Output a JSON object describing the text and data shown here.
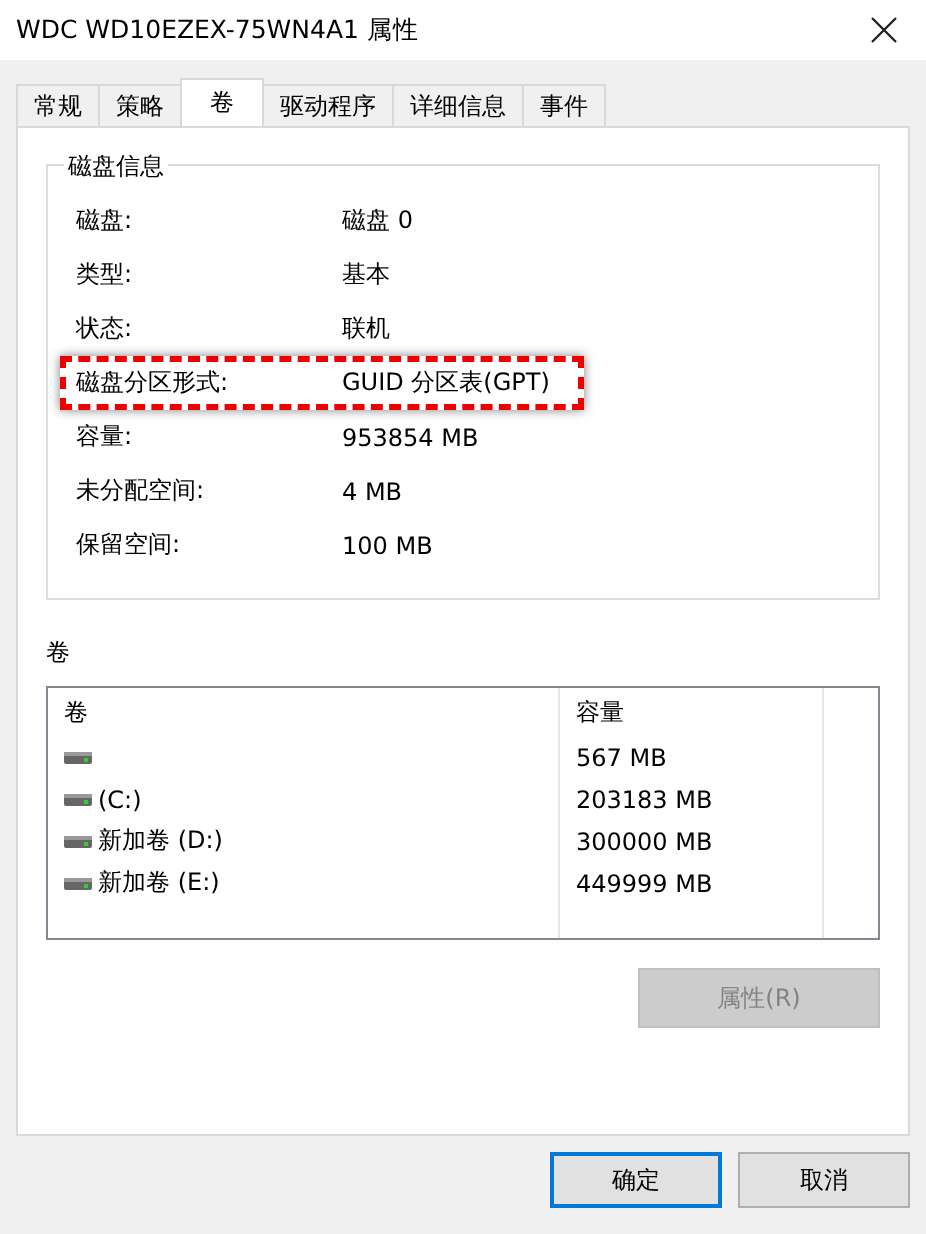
{
  "window": {
    "title": "WDC WD10EZEX-75WN4A1 属性"
  },
  "tabs": [
    {
      "label": "常规",
      "selected": false
    },
    {
      "label": "策略",
      "selected": false
    },
    {
      "label": "卷",
      "selected": true
    },
    {
      "label": "驱动程序",
      "selected": false
    },
    {
      "label": "详细信息",
      "selected": false
    },
    {
      "label": "事件",
      "selected": false
    }
  ],
  "disk_info": {
    "title": "磁盘信息",
    "rows": [
      {
        "label": "磁盘:",
        "value": "磁盘 0",
        "highlighted": false
      },
      {
        "label": "类型:",
        "value": "基本",
        "highlighted": false
      },
      {
        "label": "状态:",
        "value": "联机",
        "highlighted": false
      },
      {
        "label": "磁盘分区形式:",
        "value": "GUID 分区表(GPT)",
        "highlighted": true
      },
      {
        "label": "容量:",
        "value": "953854 MB",
        "highlighted": false
      },
      {
        "label": "未分配空间:",
        "value": "4 MB",
        "highlighted": false
      },
      {
        "label": "保留空间:",
        "value": "100 MB",
        "highlighted": false
      }
    ]
  },
  "volumes": {
    "title": "卷",
    "columns": [
      "卷",
      "容量"
    ],
    "rows": [
      {
        "name": "",
        "capacity": "567 MB"
      },
      {
        "name": " (C:)",
        "capacity": "203183 MB"
      },
      {
        "name": "新加卷 (D:)",
        "capacity": "300000 MB"
      },
      {
        "name": "新加卷 (E:)",
        "capacity": "449999 MB"
      }
    ],
    "properties_button": {
      "label": "属性(R)",
      "disabled": true
    }
  },
  "buttons": [
    {
      "label": "确定",
      "default": true
    },
    {
      "label": "取消",
      "default": false
    }
  ]
}
